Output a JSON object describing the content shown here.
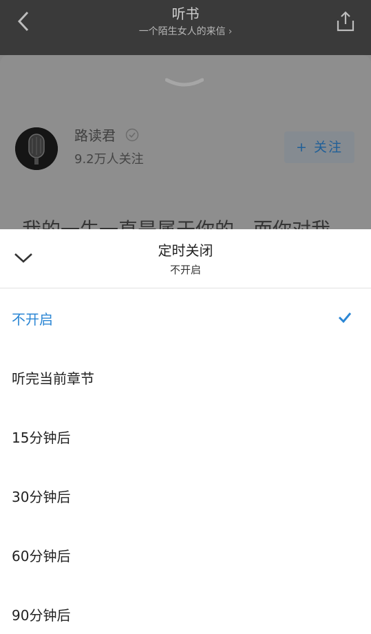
{
  "header": {
    "title": "听书",
    "subtitle": "一个陌生女人的来信",
    "subtitle_chevron": "›"
  },
  "author": {
    "name": "路读君",
    "followers": "9.2万人关注",
    "follow_label": "+ 关注"
  },
  "preview_text": "我的一生一直是属于你的，而你对我",
  "sheet": {
    "title": "定时关闭",
    "subtitle": "不开启",
    "options": [
      {
        "label": "不开启",
        "selected": true
      },
      {
        "label": "听完当前章节",
        "selected": false
      },
      {
        "label": "15分钟后",
        "selected": false
      },
      {
        "label": "30分钟后",
        "selected": false
      },
      {
        "label": "60分钟后",
        "selected": false
      },
      {
        "label": "90分钟后",
        "selected": false
      }
    ]
  },
  "colors": {
    "accent": "#2b86d4",
    "overlay": "#8a8a8a"
  },
  "icons": {
    "back": "back-arrow-icon",
    "share": "share-icon",
    "collapse": "chevron-down-icon",
    "check": "checkmark-icon"
  }
}
